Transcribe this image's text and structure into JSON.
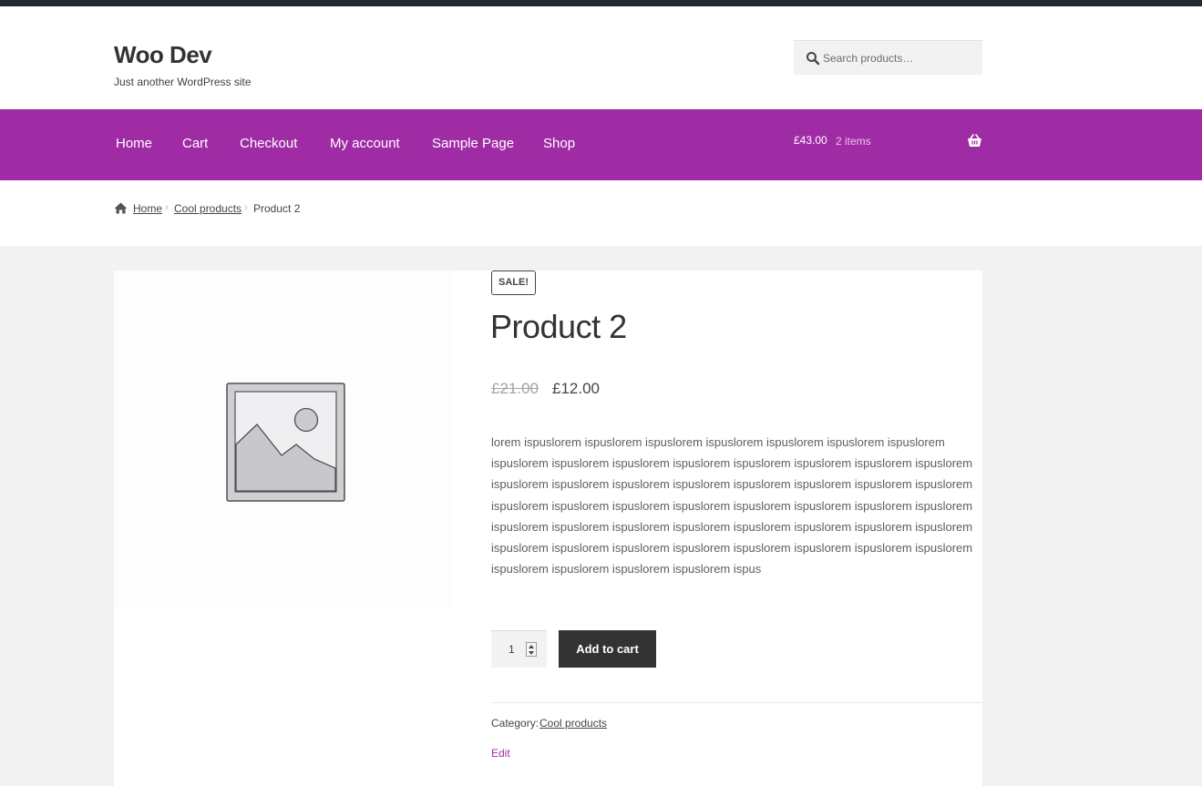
{
  "site": {
    "title": "Woo Dev",
    "tagline": "Just another WordPress site"
  },
  "search": {
    "placeholder": "Search products…",
    "icon": "search-icon"
  },
  "nav": {
    "items": [
      "Home",
      "Cart",
      "Checkout",
      "My account",
      "Sample Page",
      "Shop"
    ]
  },
  "cart": {
    "total": "£43.00",
    "count": "2 items",
    "icon": "basket-icon"
  },
  "breadcrumb": {
    "home": "Home",
    "category": "Cool products",
    "current": "Product 2"
  },
  "product": {
    "badge": "SALE!",
    "title": "Product 2",
    "price_old": "£21.00",
    "price_new": "£12.00",
    "description": "lorem ispuslorem ispuslorem ispuslorem ispuslorem ispuslorem ispuslorem ispuslorem ispuslorem ispuslorem ispuslorem ispuslorem ispuslorem ispuslorem ispuslorem ispuslorem ispuslorem ispuslorem ispuslorem ispuslorem ispuslorem ispuslorem ispuslorem ispuslorem ispuslorem ispuslorem ispuslorem ispuslorem ispuslorem ispuslorem ispuslorem ispuslorem ispuslorem ispuslorem ispuslorem ispuslorem ispuslorem ispuslorem ispuslorem ispuslorem ispuslorem ispuslorem ispuslorem ispuslorem ispuslorem ispuslorem ispuslorem ispuslorem ispuslorem ispuslorem ispuslorem ispuslorem ispus",
    "quantity": "1",
    "add_to_cart_label": "Add to cart",
    "category_label": "Category:",
    "category_value": "Cool products",
    "edit_label": "Edit"
  },
  "colors": {
    "brand_purple": "#a02ca5",
    "dark_button": "#333333",
    "admin_bar": "#23282d"
  }
}
